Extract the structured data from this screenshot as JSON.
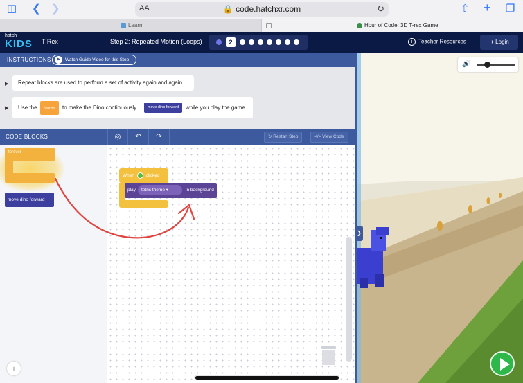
{
  "browser": {
    "url": "code.hatchxr.com",
    "text_size": "AA",
    "tabs": [
      {
        "label": "Learn"
      },
      {
        "label": "Hour of Code: 3D T-rex Game"
      }
    ]
  },
  "header": {
    "logo_top": "hatch",
    "logo_bottom": "KIDS",
    "project_name": "T Rex",
    "step_title": "Step 2: Repeated Motion (Loops)",
    "current_step": "2",
    "teacher_resources": "Teacher Resources",
    "login": "Login"
  },
  "instructions": {
    "label": "INSTRUCTIONS",
    "watch_video": "Watch Guide Video for this Step",
    "line1": "Repeat blocks are used to perform a set of activity again and again.",
    "line2_use": "Use the",
    "line2_block1": "forever",
    "line2_mid": "to make the Dino continuously",
    "line2_block2": "move dino forward",
    "line2_end": "while you play the game"
  },
  "code_blocks": {
    "label": "CODE BLOCKS",
    "forever": "forever",
    "move_dino": "move dino forward"
  },
  "toolbar": {
    "restart": "Restart Step",
    "view_code": "View Code"
  },
  "workspace": {
    "when": "When",
    "clicked": "clicked",
    "play": "play",
    "sound": "tetris theme",
    "background": "in background"
  },
  "colors": {
    "header_bg": "#0b1a45",
    "panel_blue": "#3d5a9e",
    "loop_orange": "#f3b23d",
    "event_yellow": "#f3c13d",
    "motion_blue": "#3c3f9e",
    "sound_purple": "#5b4396",
    "annotation_red": "#e0443f",
    "go_green": "#2fb74a"
  }
}
